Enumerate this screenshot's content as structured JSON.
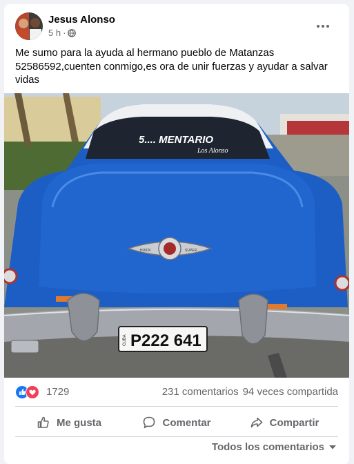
{
  "post": {
    "author": "Jesus Alonso",
    "time": "5 h",
    "separator": "·",
    "privacy_icon": "globe-icon",
    "text": "Me sumo para la ayuda al hermano pueblo de Matanzas 52586592,cuenten conmigo,es ora de unir fuerzas y ayudar a salvar vidas"
  },
  "photo": {
    "windshield_text": "5.... MENTARIO",
    "windshield_subtext": "Los Alonso",
    "emblem_left": "HUICK",
    "emblem_right": "SUPER",
    "plate_country": "CUBA",
    "plate_number": "P222 641"
  },
  "stats": {
    "reaction_icons": [
      "like-icon",
      "love-icon"
    ],
    "reactions": "1729",
    "comments": "231 comentarios",
    "shares": "94 veces compartida"
  },
  "actions": {
    "like": "Me gusta",
    "comment": "Comentar",
    "share": "Compartir"
  },
  "comments_filter": "Todos los comentarios",
  "colors": {
    "accent": "#1877f2",
    "love": "#f33e58",
    "muted": "#65676b",
    "car_blue": "#1f5fc4"
  }
}
